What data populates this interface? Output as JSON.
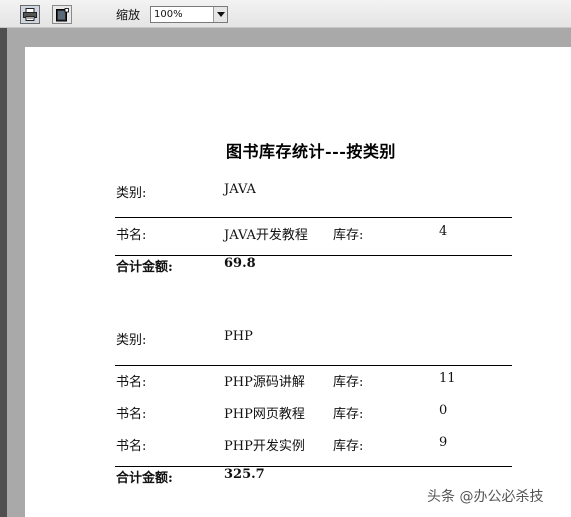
{
  "toolbar": {
    "zoom_label": "缩放",
    "zoom_value": "100%"
  },
  "report": {
    "title": "图书库存统计---按类别",
    "groups": [
      {
        "category_label": "类别:",
        "category": "JAVA",
        "books": [
          {
            "name_label": "书名:",
            "name": "JAVA开发教程",
            "stock_label": "库存:",
            "stock": "4"
          }
        ],
        "total_label": "合计金额:",
        "total": "69.8"
      },
      {
        "category_label": "类别:",
        "category": "PHP",
        "books": [
          {
            "name_label": "书名:",
            "name": "PHP源码讲解",
            "stock_label": "库存:",
            "stock": "11"
          },
          {
            "name_label": "书名:",
            "name": "PHP网页教程",
            "stock_label": "库存:",
            "stock": "0"
          },
          {
            "name_label": "书名:",
            "name": "PHP开发实例",
            "stock_label": "库存:",
            "stock": "9"
          }
        ],
        "total_label": "合计金额:",
        "total": "325.7"
      }
    ]
  },
  "watermark": "头条 @办公必杀技"
}
